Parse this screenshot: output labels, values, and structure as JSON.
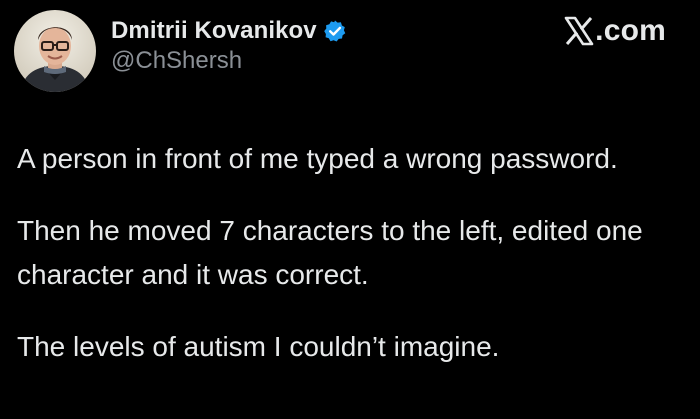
{
  "author": {
    "display_name": "Dmitrii Kovanikov",
    "handle": "@ChShersh",
    "verified": true
  },
  "brand": {
    "text": ".com",
    "icon": "x-logo-icon"
  },
  "tweet": {
    "paragraphs": [
      "A person in front of me typed a wrong password.",
      "Then he moved 7 characters to the left, edited one character and it was correct.",
      "The levels of autism I couldn’t imagine."
    ]
  },
  "colors": {
    "background": "#000000",
    "text": "#e7e9ea",
    "secondary_text": "#8b9096",
    "verified_badge": "#1d9bf0"
  }
}
